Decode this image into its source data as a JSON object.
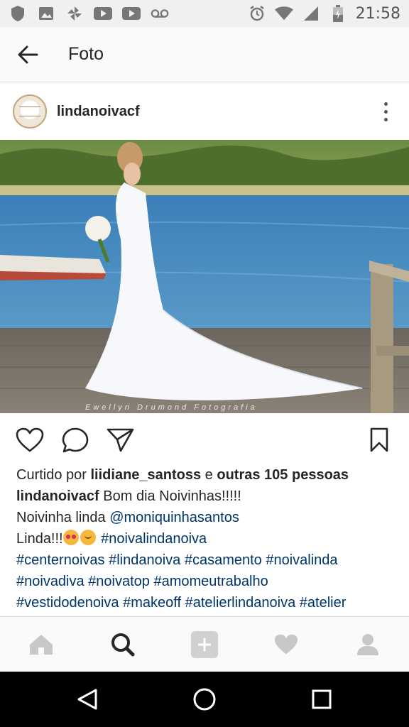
{
  "status_bar": {
    "time": "21:58",
    "left_icons": [
      "shield-icon",
      "image-icon",
      "pinwheel-icon",
      "youtube-icon",
      "youtube-icon",
      "voicemail-icon"
    ],
    "right_icons": [
      "alarm-icon",
      "wifi-icon",
      "signal-icon",
      "battery-icon"
    ]
  },
  "app_bar": {
    "title": "Foto",
    "back_icon": "arrow-left-icon"
  },
  "post": {
    "username": "lindanoivacf",
    "photo_credit": "Ewellyn Drumond Fotografia",
    "likes": {
      "prefix": "Curtido por ",
      "user": "liidiane_santoss",
      "middle": " e ",
      "others": "outras 105 pessoas"
    },
    "caption": {
      "author": "lindanoivacf",
      "line1_text": " Bom dia Noivinhas!!!!!",
      "line2_text": "Noivinha linda ",
      "line2_mention": "@moniquinhasantos",
      "line3_text": "Linda!!!",
      "line3_tag": "#noivalindanoiva",
      "line4": "#centernoivas #lindanoiva #casamento #noivalinda",
      "line5": "#noivadiva #noivatop #amomeutrabalho",
      "line6": "#vestidodenoiva #makeoff #atelierlindanoiva #atelier"
    }
  },
  "actions": [
    "heart-icon",
    "comment-icon",
    "share-icon",
    "bookmark-icon"
  ],
  "bottom_nav": [
    "home-icon",
    "search-icon",
    "add-icon",
    "activity-icon",
    "profile-icon"
  ],
  "system_nav": [
    "back-triangle-icon",
    "home-circle-icon",
    "recents-square-icon"
  ],
  "colors": {
    "hashtag": "#003569",
    "text": "#262626",
    "status_bar": "#f0f0f0",
    "system_nav": "#000000"
  }
}
